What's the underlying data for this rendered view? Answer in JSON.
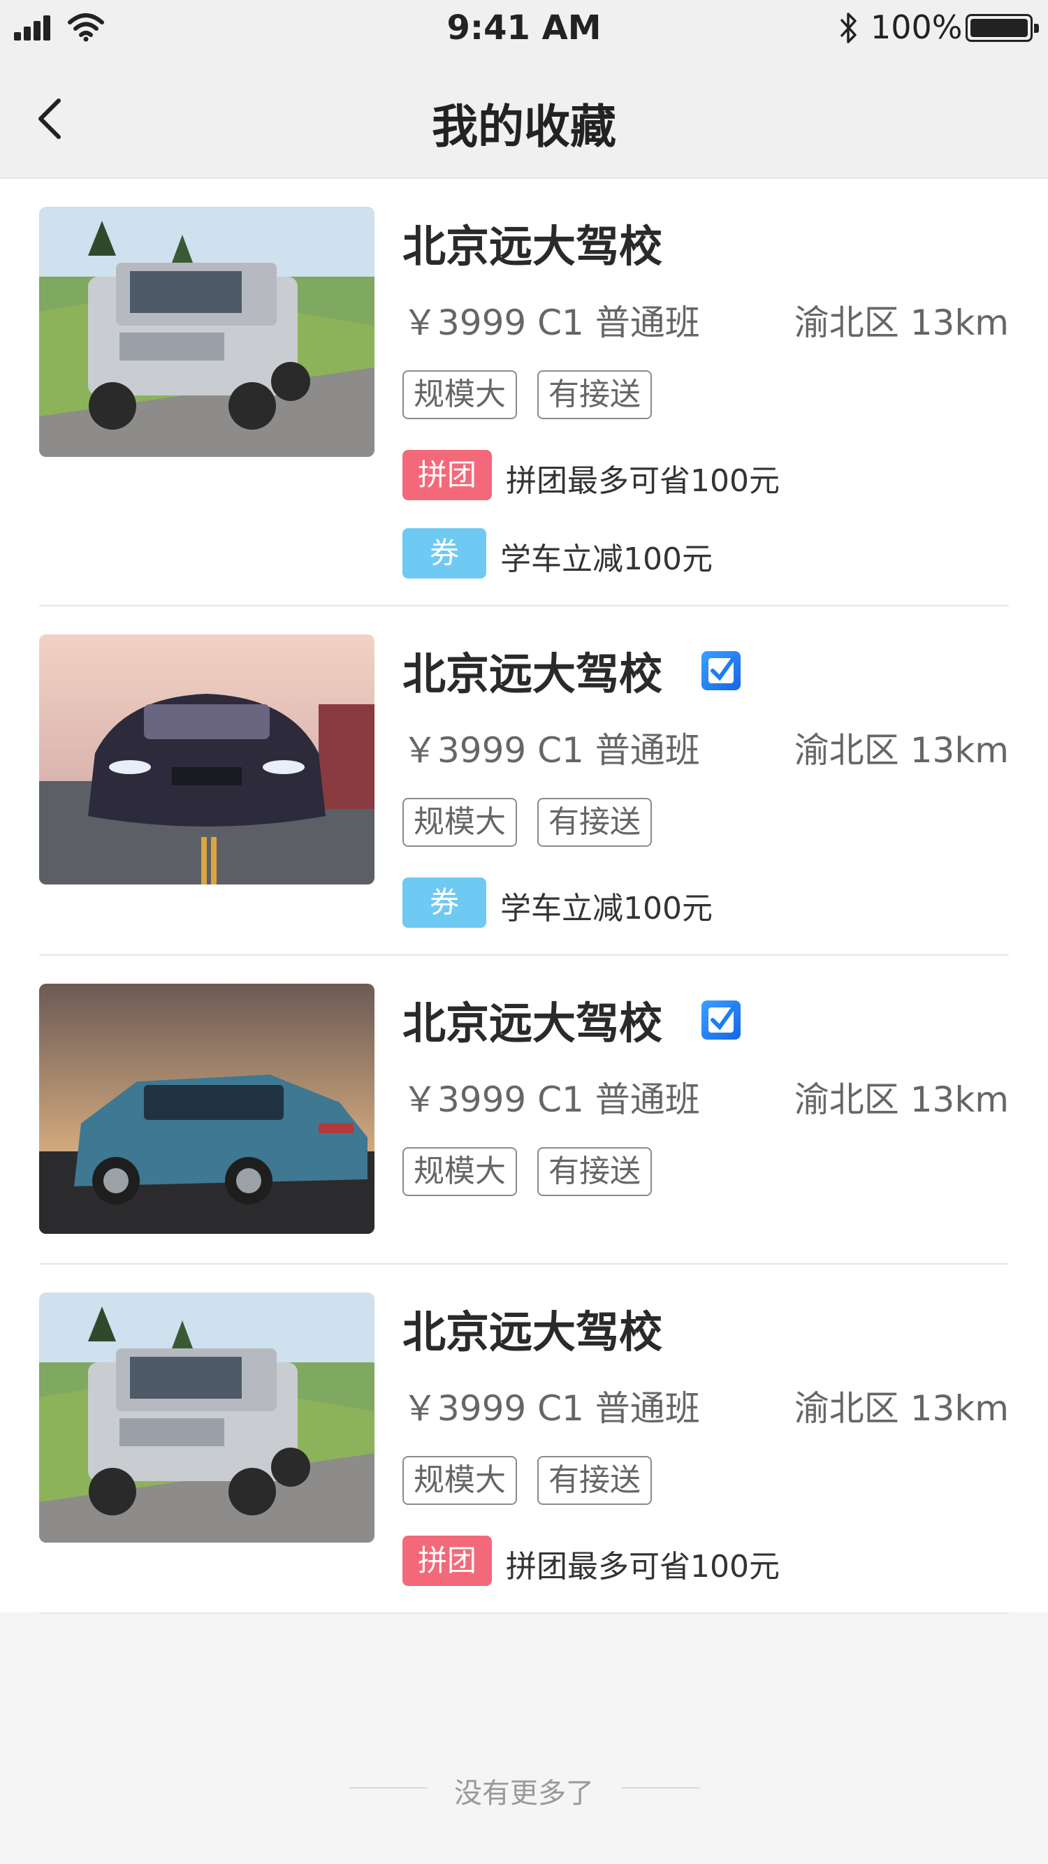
{
  "status_bar": {
    "time": "9:41 AM",
    "battery": "100%"
  },
  "nav": {
    "title": "我的收藏"
  },
  "items": [
    {
      "name": "北京远大驾校",
      "verified": false,
      "price": "￥3999 C1 普通班",
      "distance": "渝北区 13km",
      "tags": [
        "规模大",
        "有接送"
      ],
      "promos": [
        {
          "badge": "拼团",
          "text": "拼团最多可省100元"
        },
        {
          "badge": "券",
          "text": "学车立减100元"
        }
      ]
    },
    {
      "name": "北京远大驾校",
      "verified": true,
      "price": "￥3999 C1 普通班",
      "distance": "渝北区 13km",
      "tags": [
        "规模大",
        "有接送"
      ],
      "promos": [
        {
          "badge": "券",
          "text": "学车立减100元"
        }
      ]
    },
    {
      "name": "北京远大驾校",
      "verified": true,
      "price": "￥3999 C1 普通班",
      "distance": "渝北区 13km",
      "tags": [
        "规模大",
        "有接送"
      ],
      "promos": []
    },
    {
      "name": "北京远大驾校",
      "verified": false,
      "price": "￥3999 C1 普通班",
      "distance": "渝北区 13km",
      "tags": [
        "规模大",
        "有接送"
      ],
      "promos": [
        {
          "badge": "拼团",
          "text": "拼团最多可省100元"
        }
      ]
    }
  ],
  "footer": {
    "end_text": "没有更多了"
  },
  "colors": {
    "group_badge": "#f3697a",
    "coupon_badge": "#6fcaf3",
    "verified": "#1e7ef0"
  },
  "icons": {
    "back": "chevron-left-icon",
    "verified": "verified-check-icon"
  }
}
